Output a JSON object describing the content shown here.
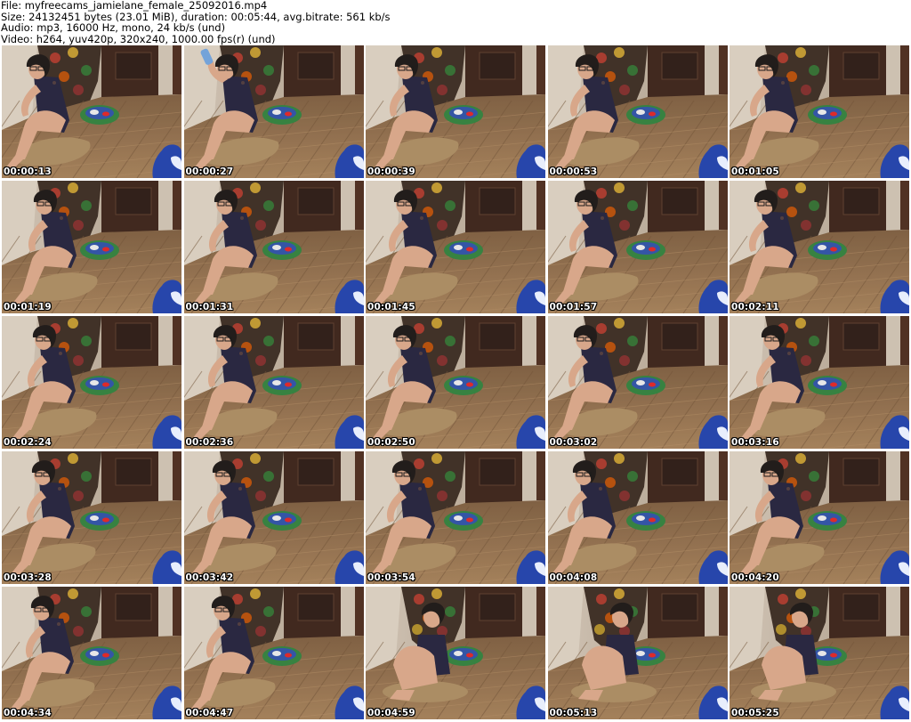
{
  "header": {
    "file_line": "File: myfreecams_jamielane_female_25092016.mp4",
    "size_line": "Size: 24132451 bytes (23.01 MiB), duration: 00:05:44, avg.bitrate: 561 kb/s",
    "audio_line": "Audio: mp3, 16000 Hz, mono, 24 kb/s (und)",
    "video_line": "Video: h264, yuv420p, 320x240, 1000.00 fps(r) (und)"
  },
  "thumbnails": [
    {
      "timestamp": "00:00:13",
      "pose": "sit"
    },
    {
      "timestamp": "00:00:27",
      "pose": "drink"
    },
    {
      "timestamp": "00:00:39",
      "pose": "sit"
    },
    {
      "timestamp": "00:00:53",
      "pose": "sit"
    },
    {
      "timestamp": "00:01:05",
      "pose": "sit"
    },
    {
      "timestamp": "00:01:19",
      "pose": "sit"
    },
    {
      "timestamp": "00:01:31",
      "pose": "sit"
    },
    {
      "timestamp": "00:01:45",
      "pose": "sit"
    },
    {
      "timestamp": "00:01:57",
      "pose": "sit"
    },
    {
      "timestamp": "00:02:11",
      "pose": "sit"
    },
    {
      "timestamp": "00:02:24",
      "pose": "sit"
    },
    {
      "timestamp": "00:02:36",
      "pose": "sit"
    },
    {
      "timestamp": "00:02:50",
      "pose": "sit"
    },
    {
      "timestamp": "00:03:02",
      "pose": "sit"
    },
    {
      "timestamp": "00:03:16",
      "pose": "sit"
    },
    {
      "timestamp": "00:03:28",
      "pose": "sit"
    },
    {
      "timestamp": "00:03:42",
      "pose": "sit"
    },
    {
      "timestamp": "00:03:54",
      "pose": "sit"
    },
    {
      "timestamp": "00:04:08",
      "pose": "sit"
    },
    {
      "timestamp": "00:04:20",
      "pose": "sit"
    },
    {
      "timestamp": "00:04:34",
      "pose": "sit"
    },
    {
      "timestamp": "00:04:47",
      "pose": "sit"
    },
    {
      "timestamp": "00:04:59",
      "pose": "hug"
    },
    {
      "timestamp": "00:05:13",
      "pose": "hug"
    },
    {
      "timestamp": "00:05:25",
      "pose": "hug"
    }
  ],
  "colors": {
    "page_background": "#ffffff",
    "header_text": "#000000",
    "timestamp_text": "#ffffff",
    "timestamp_outline": "#000000",
    "floor": "#8a6a47",
    "wall": "#b9a996",
    "door": "#3a2116",
    "pillow": "#a8895e",
    "skin": "#d7a486",
    "dress": "#22203a",
    "blue_object": "#1f3fa8"
  }
}
